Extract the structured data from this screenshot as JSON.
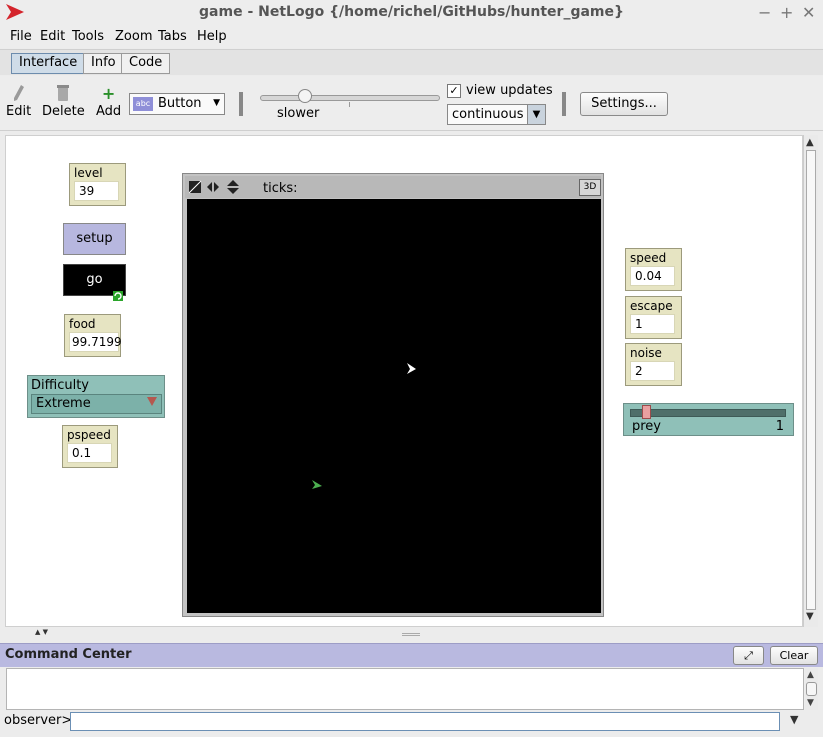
{
  "window": {
    "title": "game - NetLogo {/home/richel/GitHubs/hunter_game}",
    "controls": [
      "−",
      "+",
      "✕"
    ]
  },
  "menu": [
    "File",
    "Edit",
    "Tools",
    "Zoom",
    "Tabs",
    "Help"
  ],
  "tabs": [
    {
      "label": "Interface",
      "active": true
    },
    {
      "label": "Info",
      "active": false
    },
    {
      "label": "Code",
      "active": false
    }
  ],
  "toolbar": {
    "edit_label": "Edit",
    "delete_label": "Delete",
    "add_label": "Add",
    "widget_type": "Button",
    "widget_icon": "abc",
    "speed_label": "slower",
    "speed_level": 0.25,
    "view_updates_label": "view updates",
    "view_updates_checked": "✓",
    "update_mode": "continuous",
    "settings_label": "Settings..."
  },
  "widgets": {
    "level": {
      "label": "level",
      "value": "39"
    },
    "setup": {
      "label": "setup"
    },
    "go": {
      "label": "go",
      "forever": true
    },
    "food": {
      "label": "food",
      "value": "99.7199"
    },
    "difficulty": {
      "label": "Difficulty",
      "value": "Extreme"
    },
    "pspeed": {
      "label": "pspeed",
      "value": "0.1"
    },
    "speed": {
      "label": "speed",
      "value": "0.04"
    },
    "escape": {
      "label": "escape",
      "value": "1"
    },
    "noise": {
      "label": "noise",
      "value": "2"
    },
    "prey": {
      "label": "prey",
      "value": "1",
      "fraction": 0.08
    }
  },
  "view": {
    "ticks_label": "ticks:",
    "three_d_label": "3D",
    "background": "#000000",
    "agents": [
      {
        "name": "hunter",
        "color": "#ffffff"
      },
      {
        "name": "prey",
        "color": "#4caf50"
      }
    ]
  },
  "command_center": {
    "title": "Command Center",
    "clear_label": "Clear",
    "observer_label": "observer>",
    "input_value": ""
  },
  "colors": {
    "monitor_bg": "#e6e4c2",
    "button_bg": "#b7b7df",
    "chooser_bg": "#8fc0b8",
    "cc_header": "#b9b9e0",
    "accent_red": "#d4242c"
  }
}
